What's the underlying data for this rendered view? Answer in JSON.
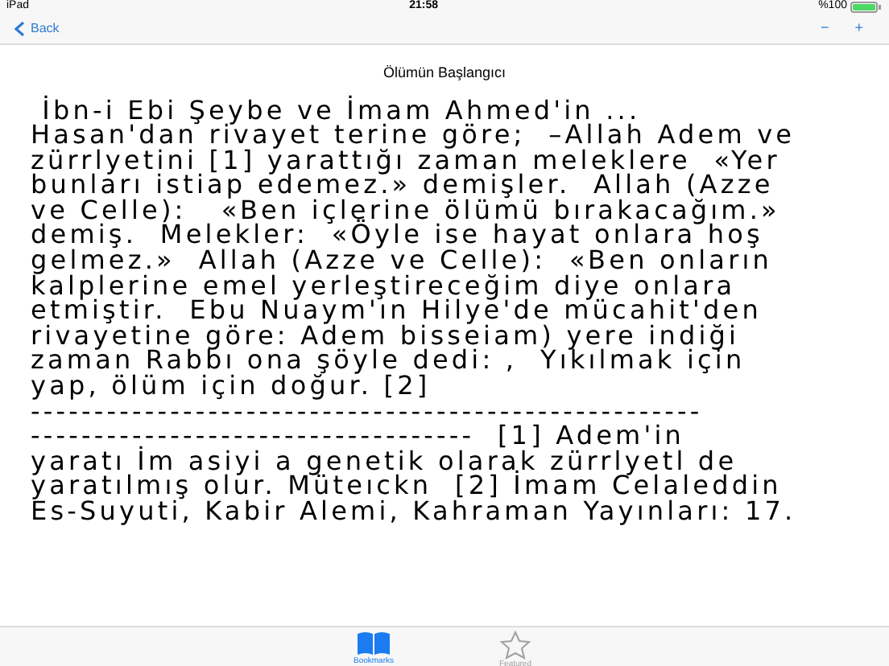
{
  "status_bar": {
    "device": "iPad",
    "time": "21:58",
    "battery": "%100"
  },
  "nav": {
    "back": "Back",
    "zoom_out": "−",
    "zoom_in": "+"
  },
  "title": "Ölümün Başlangıcı",
  "body_lines": [
    " İbn-i Ebi Şeybe ve İmam Ahmed'in ...",
    "Hasan'dan rivayet terine göre;  –Allah Adem ve",
    "zürrlyetini [1] yarattığı zaman meleklere  «Yer",
    "bunları istiap edemez.» demişler.  Allah (Azze",
    "ve Celle):   «Ben içlerine ölümü bırakacağım.»",
    "demiş.  Melekler:  «Öyle ise hayat onlara hoş",
    "gelmez.»  Allah (Azze ve Celle):  «Ben onların",
    "kalplerine emel yerleştireceğim diye onlara",
    "etmiştir.  Ebu Nuaym'ın Hilye'de mücahit'den",
    "rivayetine göre: Adem bisseiam) yere indiği",
    "zaman Rabbı ona şöyle dedi: ,  Yıkılmak için",
    "yap, ölüm için doğur. [2]",
    "-----------------------------------------------------",
    "-----------------------------------  [1] Adem'in",
    "yaratı İm asiyi a genetik olarak zürrlyetl de",
    "yaratılmış olur. Müteıckn  [2] İmam Celaleddin",
    "Es-Suyuti, Kabir Alemi, Kahraman Yayınları: 17."
  ],
  "tabs": [
    {
      "label": "Bookmarks",
      "kind": "book",
      "selected": true
    },
    {
      "label": "Featured",
      "kind": "star",
      "selected": false
    }
  ]
}
